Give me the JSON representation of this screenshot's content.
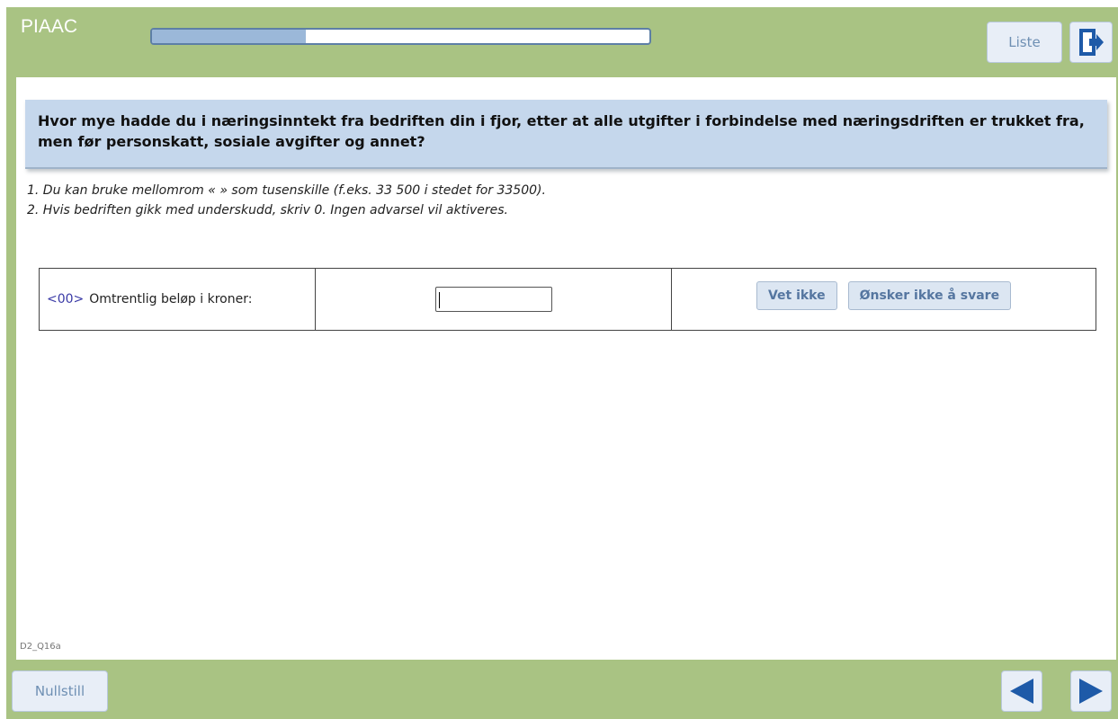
{
  "header": {
    "app_title": "PIAAC",
    "progress_fraction": 0.31,
    "liste_label": "Liste",
    "exit_icon": "exit-door-icon"
  },
  "question": {
    "text": "Hvor mye hadde du i næringsinntekt fra bedriften din i fjor, etter at alle utgifter i forbindelse med næringsdriften er trukket fra, men før personskatt, sosiale avgifter og annet?",
    "instructions": [
      "1. Du kan bruke mellomrom « » som tusenskille (f.eks. 33 500 i stedet for 33500).",
      "2. Hvis bedriften gikk med underskudd, skriv 0. Ingen advarsel vil aktiveres."
    ]
  },
  "answer": {
    "code": "<00>",
    "label": "Omtrentlig beløp i kroner:",
    "value": "",
    "vet_ikke": "Vet ikke",
    "onsker_ikke": "Ønsker ikke å svare"
  },
  "screen_id": "D2_Q16a",
  "footer": {
    "nullstill_label": "Nullstill",
    "back_icon": "arrow-left-icon",
    "next_icon": "arrow-right-icon"
  },
  "colors": {
    "frame": "#a9c383",
    "question_bg": "#c5d7ec",
    "accent": "#1e5aa8"
  }
}
